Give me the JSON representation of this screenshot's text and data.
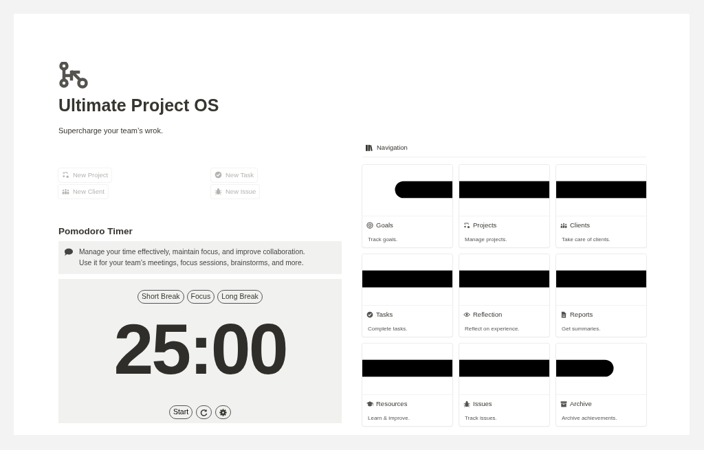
{
  "page": {
    "title": "Ultimate Project OS",
    "subtitle": "Supercharge your team’s wrok."
  },
  "quick_actions": [
    {
      "label": "New Project"
    },
    {
      "label": "New Task"
    },
    {
      "label": "New Client"
    },
    {
      "label": "New Issue"
    }
  ],
  "pomodoro": {
    "heading": "Pomodoro Timer",
    "callout": "Manage your time effectively, maintain focus, and improve collaboration. Use it for your team’s meetings, focus sessions, brainstorms, and more.",
    "modes": [
      "Short Break",
      "Focus",
      "Long Break"
    ],
    "time": "25:00",
    "start": "Start"
  },
  "navigation": {
    "heading": "Navigation",
    "cards": [
      {
        "title": "Goals",
        "description": "Track goals."
      },
      {
        "title": "Projects",
        "description": "Manage projects."
      },
      {
        "title": "Clients",
        "description": "Take care of clients."
      },
      {
        "title": "Tasks",
        "description": "Complete tasks."
      },
      {
        "title": "Reflection",
        "description": "Reflect on experience."
      },
      {
        "title": "Reports",
        "description": "Get summaries."
      },
      {
        "title": "Resources",
        "description": "Learn & improve."
      },
      {
        "title": "Issues",
        "description": "Track issues."
      },
      {
        "title": "Archive",
        "description": "Archive achievements."
      }
    ]
  }
}
